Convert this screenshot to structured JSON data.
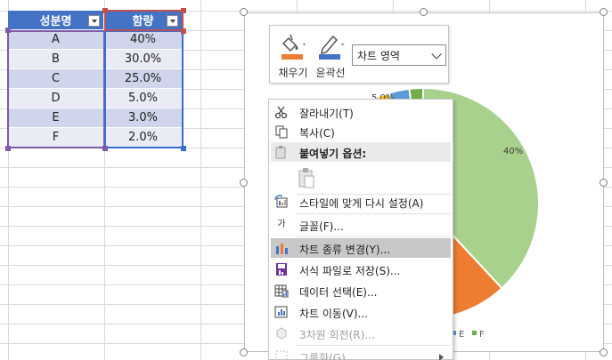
{
  "table": {
    "headers": [
      "성분명",
      "함량"
    ],
    "rows": [
      [
        "A",
        "40%"
      ],
      [
        "B",
        "30.0%"
      ],
      [
        "C",
        "25.0%"
      ],
      [
        "D",
        "5.0%"
      ],
      [
        "E",
        "3.0%"
      ],
      [
        "F",
        "2.0%"
      ]
    ]
  },
  "chart_data": {
    "type": "pie",
    "categories": [
      "A",
      "B",
      "C",
      "D",
      "E",
      "F"
    ],
    "values": [
      40,
      30,
      25,
      5,
      3,
      2
    ],
    "data_labels": [
      "40%",
      "5.0%"
    ],
    "legend": [
      "E",
      "F"
    ],
    "legend_placement": "bottom"
  },
  "colors": {
    "A": "#a9d18e",
    "B": "#ed7d31",
    "C": "#a5a5a5",
    "D": "#ffc000",
    "E": "#5b9bd5",
    "F": "#70ad47",
    "table_header": "#4472c4"
  },
  "mini_toolbar": {
    "fill_label": "채우기",
    "outline_label": "윤곽선",
    "element_select": "차트 영역"
  },
  "context_menu": {
    "cut": "잘라내기(T)",
    "copy": "복사(C)",
    "paste_options": "붙여넣기 옵션:",
    "reset_style": "스타일에 맞게 다시 설정(A)",
    "font": "글꼴(F)...",
    "change_chart_type": "차트 종류 변경(Y)...",
    "save_template": "서식 파일로 저장(S)...",
    "select_data": "데이터 선택(E)...",
    "move_chart": "차트 이동(V)...",
    "rotation_3d": "3차원 회전(R)...",
    "group": "그룹화(G)"
  }
}
